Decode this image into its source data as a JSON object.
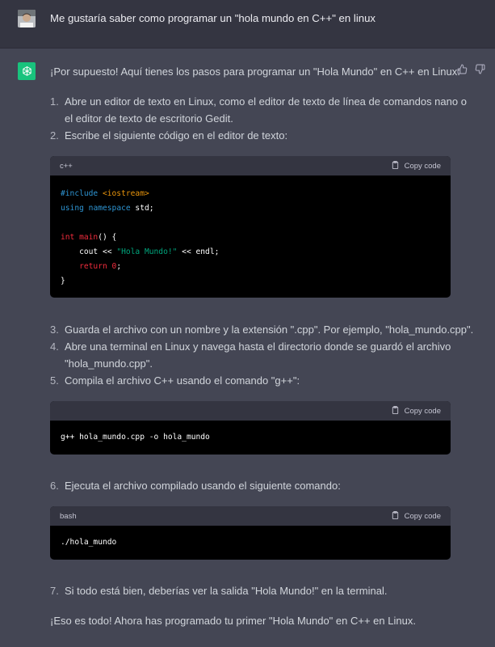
{
  "user_message": "Me gustaría saber como programar un \"hola mundo en C++\" en linux",
  "assistant": {
    "intro": "¡Por supuesto! Aquí tienes los pasos para programar un \"Hola Mundo\" en C++ en Linux:",
    "steps": [
      {
        "num": "1.",
        "line1": "Abre un editor de texto en Linux, como el editor de texto de línea de comandos nano o",
        "line2": "el editor de texto de escritorio Gedit."
      },
      {
        "num": "2.",
        "line1": "Escribe el siguiente código en el editor de texto:"
      },
      {
        "num": "3.",
        "line1": "Guarda el archivo con un nombre y la extensión \".cpp\". Por ejemplo, \"hola_mundo.cpp\"."
      },
      {
        "num": "4.",
        "line1": "Abre una terminal en Linux y navega hasta el directorio donde se guardó el archivo",
        "line2": "\"hola_mundo.cpp\"."
      },
      {
        "num": "5.",
        "line1": "Compila el archivo C++ usando el comando \"g++\":"
      },
      {
        "num": "6.",
        "line1": "Ejecuta el archivo compilado usando el siguiente comando:"
      },
      {
        "num": "7.",
        "line1": "Si todo está bien, deberías ver la salida \"Hola Mundo!\" en la terminal."
      }
    ],
    "code_blocks": [
      {
        "language": "c++",
        "copy_label": "Copy code",
        "lines": {
          "l1a": "#include ",
          "l1b": "<iostream>",
          "l2a": "using",
          "l2b": " ",
          "l2c": "namespace",
          "l2d": " std;",
          "l4a": "int",
          "l4b": " ",
          "l4c": "main",
          "l4d": "() {",
          "l5a": "    cout << ",
          "l5b": "\"Hola Mundo!\"",
          "l5c": " << endl;",
          "l6a": "    ",
          "l6b": "return",
          "l6c": " ",
          "l6d": "0",
          "l6e": ";",
          "l7": "}"
        }
      },
      {
        "language": "",
        "copy_label": "Copy code",
        "code": "g++ hola_mundo.cpp -o hola_mundo"
      },
      {
        "language": "bash",
        "copy_label": "Copy code",
        "code": "./hola_mundo"
      }
    ],
    "closing": "¡Eso es todo! Ahora has programado tu primer \"Hola Mundo\" en C++ en Linux."
  },
  "icons": {
    "user_avatar": "user-photo",
    "assistant_avatar": "openai-logo",
    "thumbs_up": "thumbs-up-icon",
    "thumbs_down": "thumbs-down-icon",
    "copy": "clipboard-icon"
  },
  "colors": {
    "user_bg": "#343541",
    "assistant_bg": "#444654",
    "code_bg": "#000000",
    "code_header": "#343541",
    "gpt_green": "#19c37d"
  }
}
